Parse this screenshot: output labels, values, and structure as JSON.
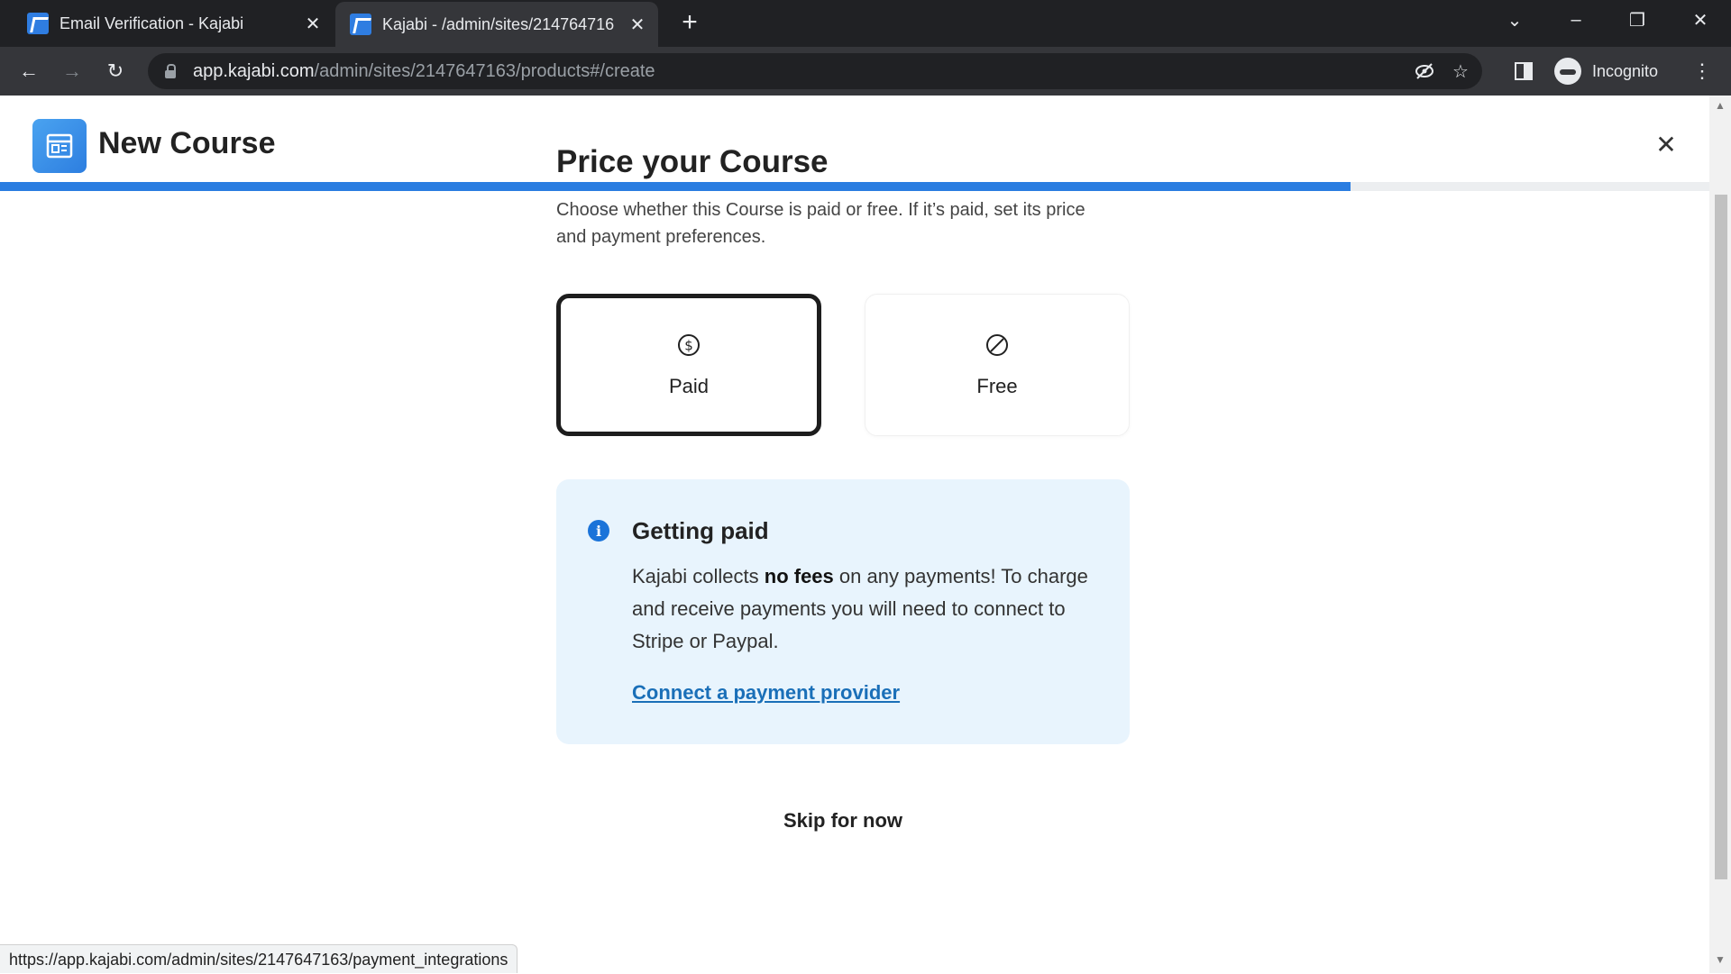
{
  "browser": {
    "tabs": [
      {
        "title": "Email Verification - Kajabi",
        "active": false
      },
      {
        "title": "Kajabi - /admin/sites/214764716",
        "active": true
      }
    ],
    "url_host": "app.kajabi.com",
    "url_path": "/admin/sites/2147647163/products#/create",
    "profile_label": "Incognito",
    "status_url": "https://app.kajabi.com/admin/sites/2147647163/payment_integrations"
  },
  "header": {
    "title": "New Course",
    "progress": 0.79
  },
  "main": {
    "heading": "Price your Course",
    "description": "Choose whether this Course is paid or free. If it’s paid, set its price and payment preferences.",
    "options": [
      {
        "label": "Paid",
        "icon": "dollar-circle-icon",
        "selected": true
      },
      {
        "label": "Free",
        "icon": "prohibited-circle-icon",
        "selected": false
      }
    ],
    "info": {
      "title": "Getting paid",
      "body_before": "Kajabi collects ",
      "body_bold": "no fees",
      "body_after": " on any payments! To charge and receive payments you will need to connect to Stripe or Paypal.",
      "link": "Connect a payment provider"
    },
    "skip_label": "Skip for now"
  },
  "colors": {
    "accent": "#2a7de1",
    "info_bg": "#e8f4fd",
    "link": "#1a6fb8"
  }
}
